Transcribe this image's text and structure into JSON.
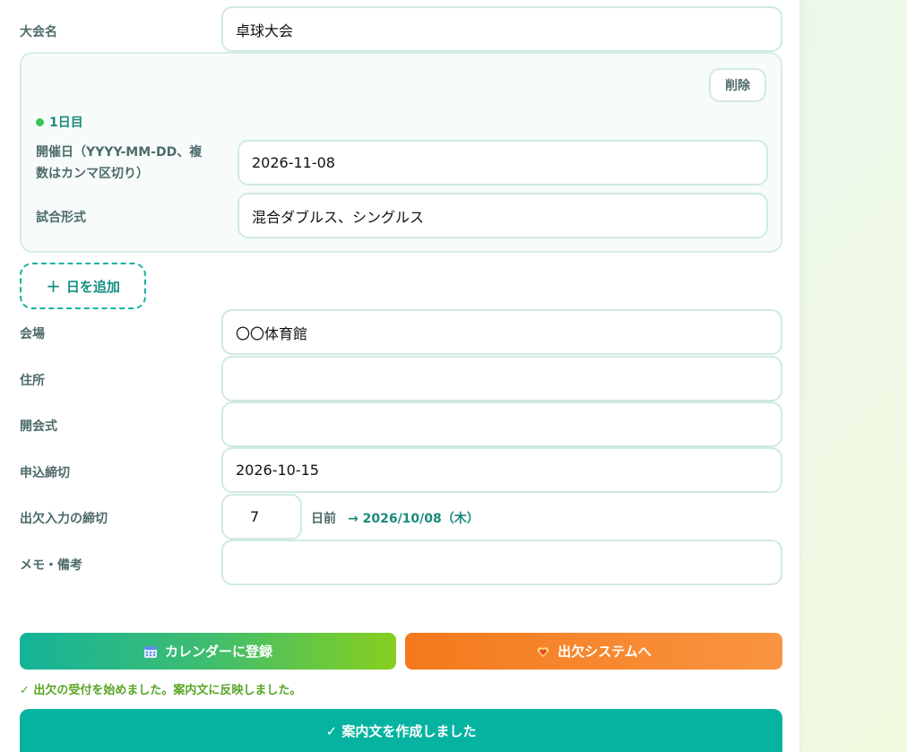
{
  "form": {
    "tournament_name": {
      "label": "大会名",
      "value": "卓球大会"
    },
    "days": [
      {
        "title": "1日目",
        "delete_label": "削除",
        "date": {
          "label_line1": "開催日（YYYY-MM-DD、複",
          "label_line2": "数はカンマ区切り）",
          "value": "2026-11-08"
        },
        "format": {
          "label": "試合形式",
          "value": "混合ダブルス、シングルス"
        }
      }
    ],
    "add_day_label": "日を追加",
    "add_day_icon": "+",
    "venue": {
      "label": "会場",
      "value": "〇〇体育館"
    },
    "address": {
      "label": "住所",
      "value": ""
    },
    "opening": {
      "label": "開会式",
      "value": ""
    },
    "entry_deadline": {
      "label": "申込締切",
      "value": "2026-10-15"
    },
    "attendance_deadline": {
      "label": "出欠入力の締切",
      "value": "7",
      "suffix": "日前",
      "computed": "→ 2026/10/08（木）"
    },
    "memo": {
      "label": "メモ・備考",
      "value": ""
    }
  },
  "actions": {
    "calendar_label": "カレンダーに登録",
    "attendance_label": "出欠システムへ",
    "status_message": "✓ 出欠の受付を始めました。案内文に反映しました。",
    "create_label": "✓ 案内文を作成しました"
  },
  "colors": {
    "accent": "#06b3a0",
    "orange": "#f47a1c",
    "green_status": "#58a523",
    "border": "#cfeae2"
  },
  "icons": {
    "calendar": "calendar-icon",
    "attendance": "heart-hand-icon",
    "dot": "status-dot-icon"
  }
}
